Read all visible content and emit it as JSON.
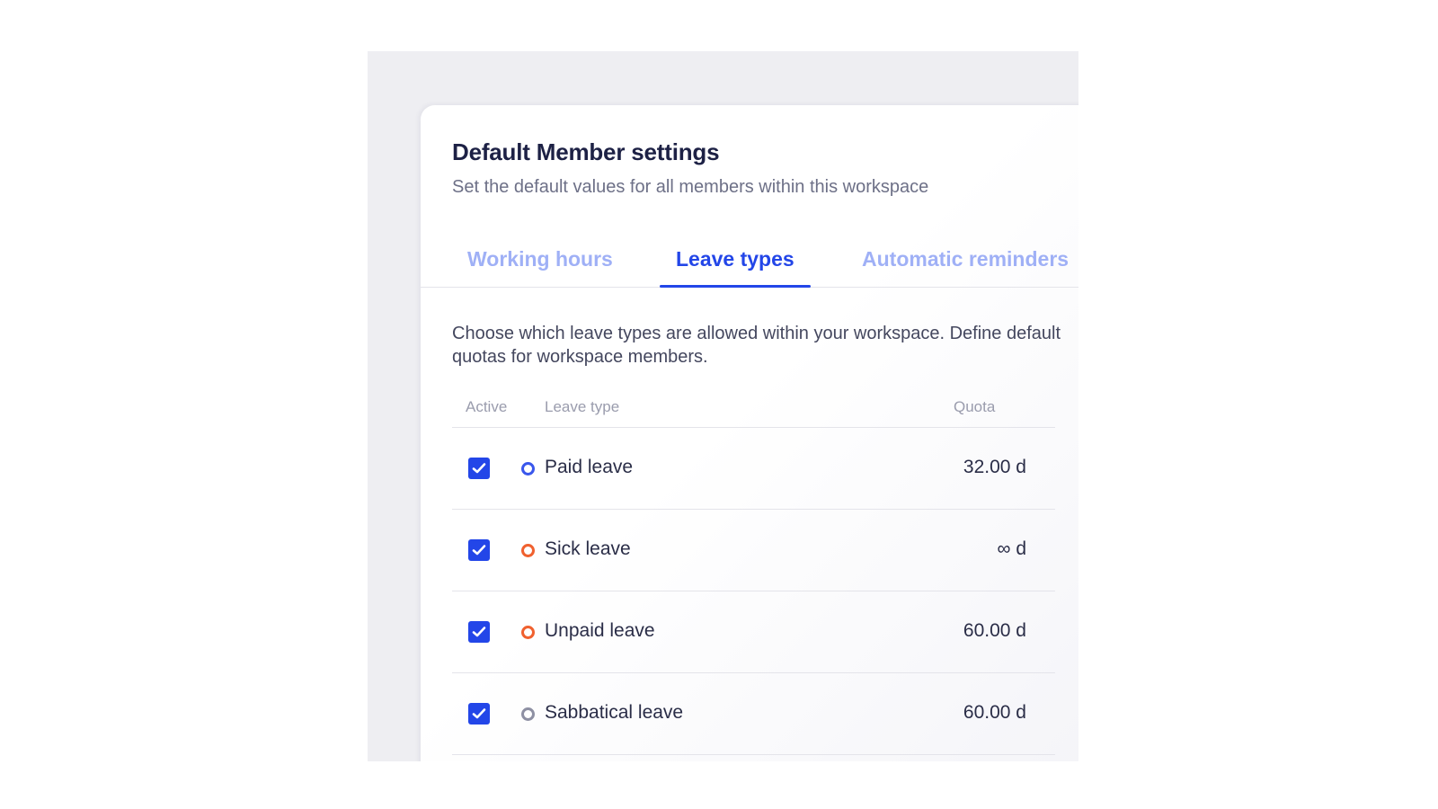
{
  "header": {
    "title": "Default Member settings",
    "subtitle": "Set the default values for all members within this workspace"
  },
  "tabs": [
    {
      "label": "Working hours",
      "active": false
    },
    {
      "label": "Leave types",
      "active": true
    },
    {
      "label": "Automatic reminders",
      "active": false
    }
  ],
  "leave_types": {
    "description": "Choose which leave types are allowed within your workspace. Define default quotas for workspace members.",
    "columns": {
      "active": "Active",
      "type": "Leave type",
      "quota": "Quota"
    },
    "rows": [
      {
        "name": "Paid leave",
        "quota": "32.00 d",
        "active": true,
        "color": "#3a57ec"
      },
      {
        "name": "Sick leave",
        "quota": "∞ d",
        "active": true,
        "color": "#f0612f"
      },
      {
        "name": "Unpaid leave",
        "quota": "60.00 d",
        "active": true,
        "color": "#f0612f"
      },
      {
        "name": "Sabbatical leave",
        "quota": "60.00 d",
        "active": true,
        "color": "#8e90a3"
      }
    ]
  },
  "colors": {
    "accent": "#2346e8",
    "inactive_tab": "#9fb0f6"
  },
  "icons": {
    "checkbox": "check-icon",
    "leave_marker": "ring-dot-icon"
  }
}
